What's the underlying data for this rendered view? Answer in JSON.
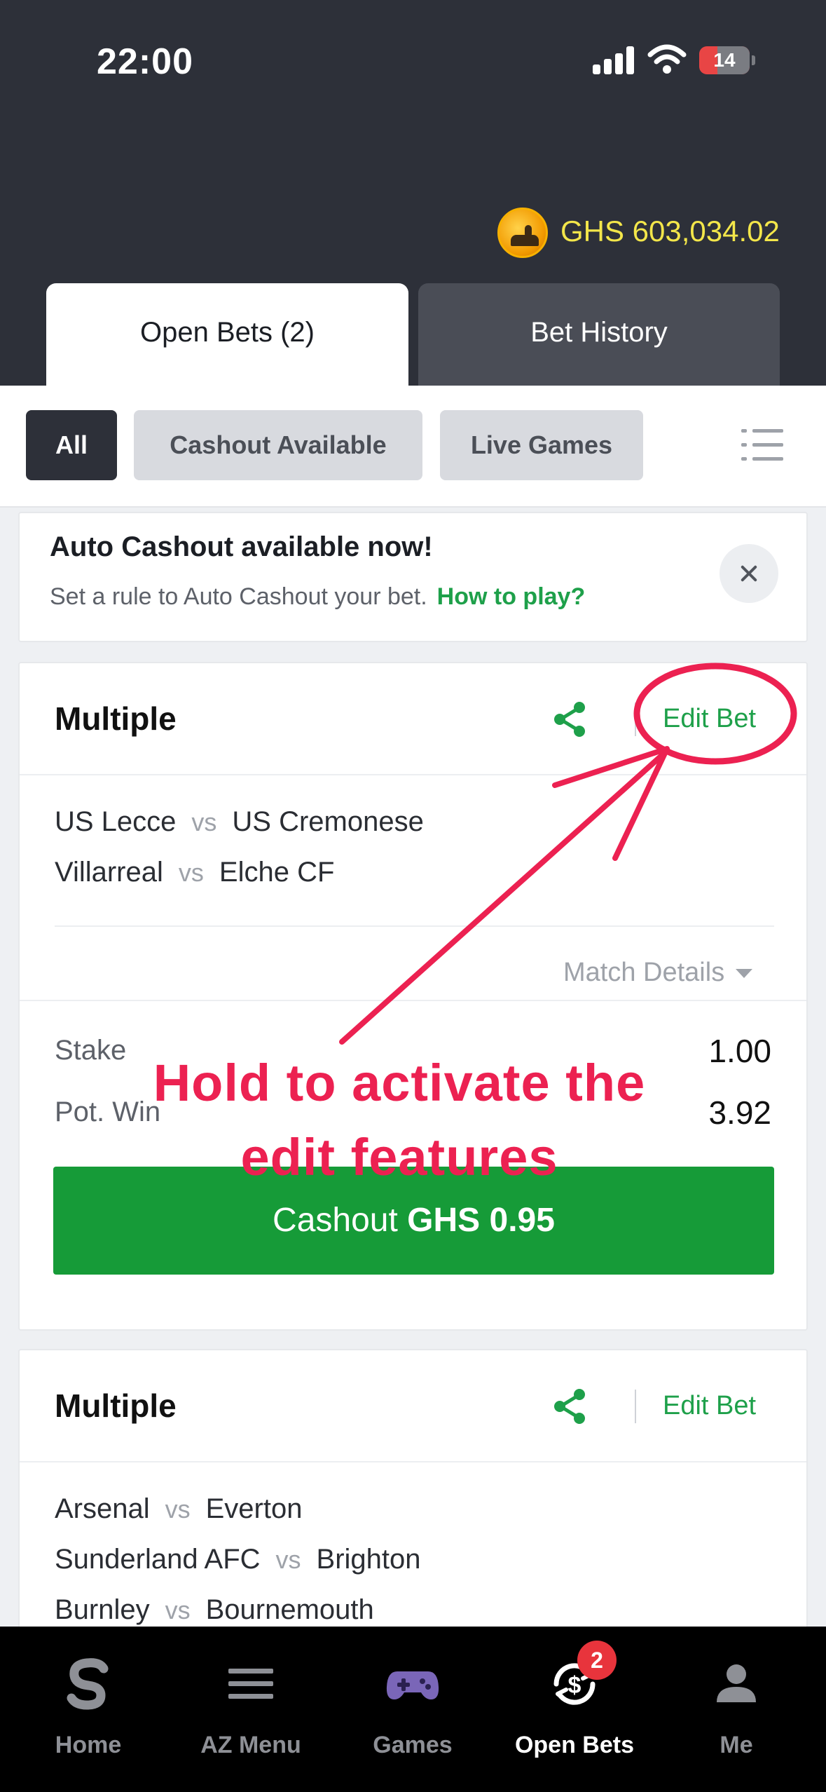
{
  "status_bar": {
    "time": "22:00",
    "battery": "14"
  },
  "account": {
    "balance": "GHS 603,034.02"
  },
  "tabs": [
    {
      "label": "Open Bets (2)",
      "active": true
    },
    {
      "label": "Bet History",
      "active": false
    }
  ],
  "filters": [
    {
      "label": "All",
      "active": true
    },
    {
      "label": "Cashout Available",
      "active": false
    },
    {
      "label": "Live Games",
      "active": false
    }
  ],
  "auto_cashout": {
    "title": "Auto Cashout available now!",
    "text": "Set a rule to Auto Cashout your bet.",
    "link": "How to play?"
  },
  "bets": [
    {
      "type": "Multiple",
      "edit_label": "Edit Bet",
      "matches": [
        {
          "home": "US Lecce",
          "vs": "vs",
          "away": "US Cremonese"
        },
        {
          "home": "Villarreal",
          "vs": "vs",
          "away": "Elche CF"
        }
      ],
      "match_details": "Match Details",
      "stake_label": "Stake",
      "stake": "1.00",
      "pot_win_label": "Pot. Win",
      "pot_win": "3.92",
      "cashout_prefix": "Cashout",
      "cashout_amount": "GHS 0.95"
    },
    {
      "type": "Multiple",
      "edit_label": "Edit Bet",
      "matches": [
        {
          "home": "Arsenal",
          "vs": "vs",
          "away": "Everton"
        },
        {
          "home": "Sunderland AFC",
          "vs": "vs",
          "away": "Brighton"
        },
        {
          "home": "Burnley",
          "vs": "vs",
          "away": "Bournemouth"
        }
      ]
    }
  ],
  "annotation": {
    "line1": "Hold to activate the",
    "line2": "edit features",
    "color": "#ec2151"
  },
  "bottom_nav": [
    {
      "label": "Home",
      "icon": "sporty-logo-icon"
    },
    {
      "label": "AZ Menu",
      "icon": "menu-icon"
    },
    {
      "label": "Games",
      "icon": "gamepad-icon"
    },
    {
      "label": "Open Bets",
      "icon": "open-bets-icon",
      "badge": "2",
      "active": true
    },
    {
      "label": "Me",
      "icon": "user-icon"
    }
  ],
  "colors": {
    "accent_green": "#1ea04a",
    "header_bg": "#2d3039",
    "balance_yellow": "#f3e64a"
  }
}
